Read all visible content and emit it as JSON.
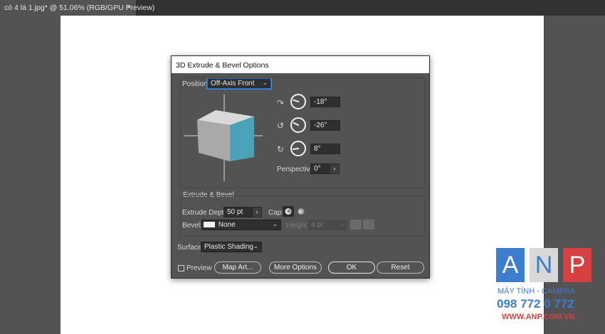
{
  "document_tab": {
    "title": "có 4 lá 1.jpg* @ 51.06% (RGB/GPU Preview)",
    "close": "×"
  },
  "dialog": {
    "title": "3D Extrude & Bevel Options",
    "position": {
      "label": "Position:",
      "value": "Off-Axis Front"
    },
    "rotation": {
      "x": "-18°",
      "y": "-26°",
      "z": "8°",
      "perspective_label": "Perspective:",
      "perspective_value": "0°"
    },
    "extrude_bevel": {
      "section_label": "Extrude & Bevel",
      "depth_label": "Extrude Depth:",
      "depth_value": "50 pt",
      "cap_label": "Cap:",
      "bevel_label": "Bevel:",
      "bevel_value": "None",
      "height_label": "Height:",
      "height_value": "4 pt"
    },
    "surface": {
      "label": "Surface:",
      "value": "Plastic Shading"
    },
    "buttons": {
      "preview": "Preview",
      "map_art": "Map Art...",
      "more_options": "More Options",
      "ok": "OK",
      "reset": "Reset"
    },
    "cube_colors": {
      "front": "#4aa3b9",
      "top": "#d9d9d9",
      "side": "#a9a9a9"
    }
  },
  "watermark": {
    "letters": [
      "A",
      "N",
      "P"
    ],
    "colors": [
      "#3c7dd0",
      "#d8d8d8",
      "#d64040"
    ],
    "line1_a": "MÁY TÍNH",
    "line1_sep": "-",
    "line1_b": "CAMERA",
    "phone": "098 772 0 772",
    "website": "WWW.ANP.COM.VN"
  }
}
